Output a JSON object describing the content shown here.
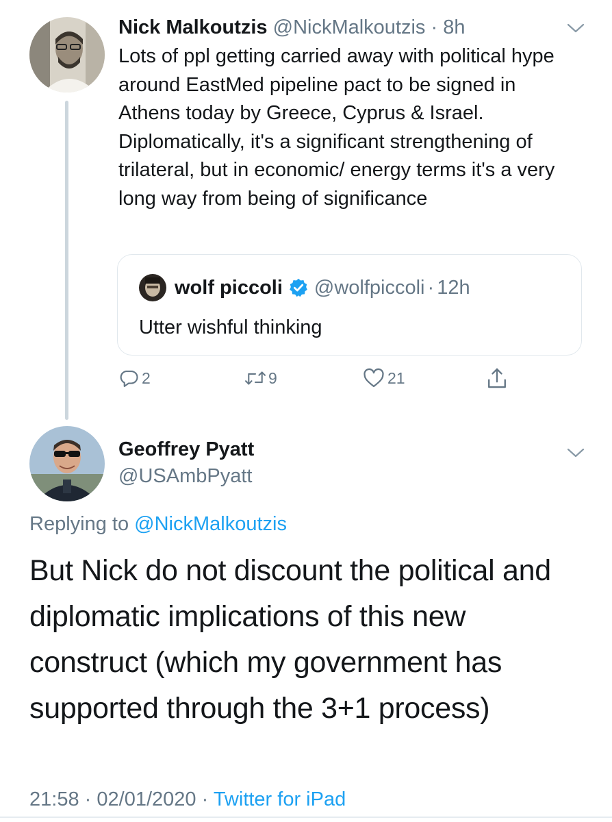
{
  "parent_tweet": {
    "author_name": "Nick Malkoutzis",
    "handle": "@NickMalkoutzis",
    "separator": "·",
    "time": "8h",
    "text": "Lots of ppl getting carried away with political hype around EastMed pipeline pact to be signed in Athens today by Greece, Cyprus & Israel. Diplomatically, it's a significant strengthening of trilateral, but in economic/ energy terms it's a very long way from being of significance",
    "quoted": {
      "author_name": "wolf piccoli",
      "handle": "@wolfpiccoli",
      "separator": "·",
      "time": "12h",
      "text": "Utter wishful thinking"
    },
    "actions": {
      "replies": "2",
      "retweets": "9",
      "likes": "21"
    }
  },
  "main_tweet": {
    "author_name": "Geoffrey Pyatt",
    "handle": "@USAmbPyatt",
    "replying_prefix": "Replying to",
    "replying_handle": "@NickMalkoutzis",
    "text": "But Nick do not discount the political and diplomatic implications of this new construct (which my government has supported through the 3+1 process)",
    "time": "21:58",
    "separator1": "·",
    "date": "02/01/2020",
    "separator2": "·",
    "source": "Twitter for iPad"
  },
  "colors": {
    "accent": "#1da1f2",
    "text": "#14171a",
    "muted": "#657786",
    "border": "#e1e8ed",
    "verified": "#1da1f2"
  },
  "icons": [
    "chevron-down-icon",
    "verified-icon",
    "reply-icon",
    "retweet-icon",
    "like-icon",
    "share-icon"
  ]
}
